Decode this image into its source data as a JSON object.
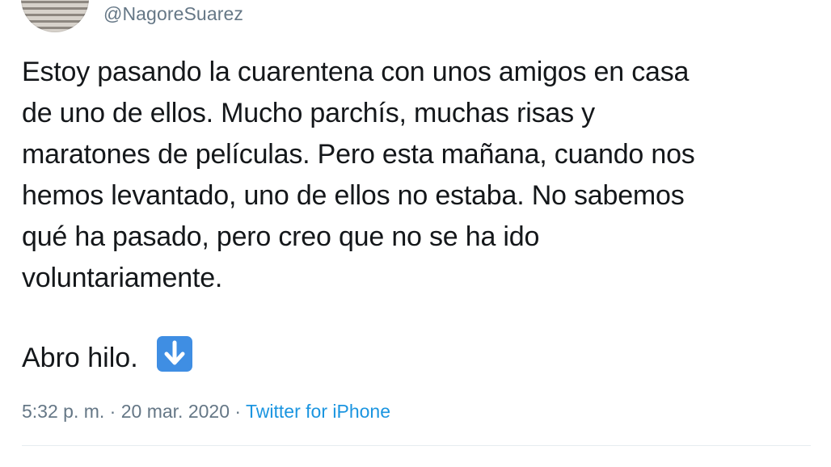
{
  "author": {
    "handle": "@NagoreSuarez"
  },
  "tweet": {
    "lines": [
      "Estoy pasando la cuarentena con unos amigos en casa",
      "de uno de ellos. Mucho parchís, muchas risas y",
      "maratones de películas. Pero esta mañana, cuando nos",
      "hemos levantado, uno de ellos no estaba. No sabemos",
      "qué ha pasado, pero creo que no se ha ido",
      "voluntariamente."
    ],
    "thread_text": "Abro hilo.",
    "thread_icon": "down-arrow-emoji-icon"
  },
  "meta": {
    "time": "5:32 p. m.",
    "separator_1": " · ",
    "date": "20 mar. 2020",
    "separator_2": " · ",
    "source": "Twitter for iPhone"
  },
  "colors": {
    "text": "#14171a",
    "muted": "#657786",
    "link": "#1b95e0",
    "divider": "#e6ecf0",
    "emoji": "#3f8ee3"
  }
}
